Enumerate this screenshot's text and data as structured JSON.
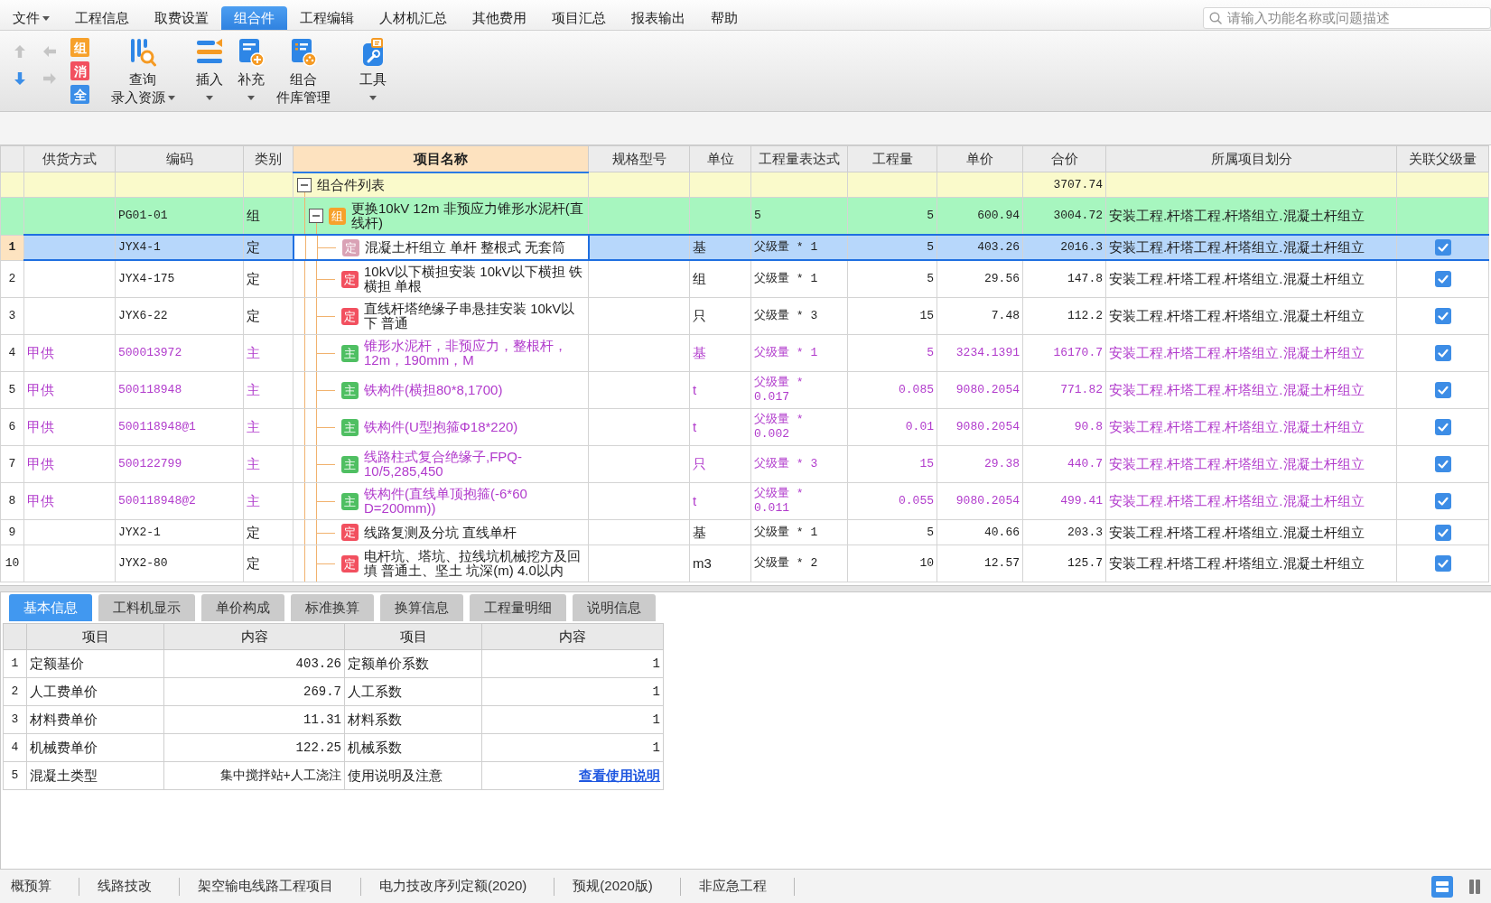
{
  "menu": {
    "items": [
      {
        "label": "文件",
        "dropdown": true,
        "selected": false
      },
      {
        "label": "工程信息",
        "dropdown": false,
        "selected": false
      },
      {
        "label": "取费设置",
        "dropdown": false,
        "selected": false
      },
      {
        "label": "组合件",
        "dropdown": false,
        "selected": true
      },
      {
        "label": "工程编辑",
        "dropdown": false,
        "selected": false
      },
      {
        "label": "人材机汇总",
        "dropdown": false,
        "selected": false
      },
      {
        "label": "其他费用",
        "dropdown": false,
        "selected": false
      },
      {
        "label": "项目汇总",
        "dropdown": false,
        "selected": false
      },
      {
        "label": "报表输出",
        "dropdown": false,
        "selected": false
      },
      {
        "label": "帮助",
        "dropdown": false,
        "selected": false
      }
    ]
  },
  "search": {
    "placeholder": "请输入功能名称或问题描述"
  },
  "toolbar": {
    "nav": [
      {
        "kind": "up",
        "disabled": true
      },
      {
        "kind": "back",
        "disabled": true
      },
      {
        "kind": "down",
        "disabled": false
      },
      {
        "kind": "forward",
        "disabled": true
      }
    ],
    "quick_buttons": [
      {
        "label": "组",
        "color": "#f7a12b"
      },
      {
        "label": "消",
        "color": "#f2505f"
      },
      {
        "label": "全",
        "color": "#3b8ee8"
      }
    ],
    "buttons": [
      {
        "kind": "query",
        "lines": [
          "查询",
          "录入资源"
        ],
        "dropdown": true
      },
      {
        "kind": "insert",
        "lines": [
          "插入"
        ],
        "dropdown": true
      },
      {
        "kind": "supplement",
        "lines": [
          "补充"
        ],
        "dropdown": true
      },
      {
        "kind": "library",
        "lines": [
          "组合",
          "件库管理"
        ],
        "dropdown": false
      },
      {
        "kind": "tools",
        "lines": [
          "工具"
        ],
        "dropdown": true
      }
    ]
  },
  "grid": {
    "columns": [
      {
        "label": "供货方式",
        "selected": false
      },
      {
        "label": "编码",
        "selected": false
      },
      {
        "label": "类别",
        "selected": false
      },
      {
        "label": "项目名称",
        "selected": true
      },
      {
        "label": "规格型号",
        "selected": false
      },
      {
        "label": "单位",
        "selected": false
      },
      {
        "label": "工程量表达式",
        "selected": false
      },
      {
        "label": "工程量",
        "selected": false
      },
      {
        "label": "单价",
        "selected": false
      },
      {
        "label": "合价",
        "selected": false
      },
      {
        "label": "所属项目划分",
        "selected": false
      },
      {
        "label": "关联父级量",
        "selected": false
      }
    ],
    "tree": [
      {
        "kind": "list",
        "name": "组合件列表",
        "total": "3707.74",
        "expanded": true,
        "selected": false,
        "children": [
          {
            "kind": "group",
            "code": "PG01-01",
            "type": "组",
            "badge": "组",
            "name": "更换10kV 12m 非预应力锥形水泥杆(直线杆)",
            "expression": "5",
            "quantity": "5",
            "unit_price": "600.94",
            "total": "3004.72",
            "division": "安装工程.杆塔工程.杆塔组立.混凝土杆组立",
            "expanded": true,
            "selected": false,
            "children": [
              {
                "kind": "quota",
                "no": "1",
                "code": "JYX4-1",
                "type": "定",
                "badge": "定",
                "name": "混凝土杆组立 单杆 整根式 无套筒",
                "unit": "基",
                "expression": "父级量 * 1",
                "quantity": "5",
                "unit_price": "403.26",
                "total": "2016.3",
                "division": "安装工程.杆塔工程.杆塔组立.混凝土杆组立",
                "linked": true,
                "selected": true
              },
              {
                "kind": "quota",
                "no": "2",
                "code": "JYX4-175",
                "type": "定",
                "badge": "定",
                "name": "10kV以下横担安装 10kV以下横担 铁横担 单根",
                "unit": "组",
                "expression": "父级量 * 1",
                "quantity": "5",
                "unit_price": "29.56",
                "total": "147.8",
                "division": "安装工程.杆塔工程.杆塔组立.混凝土杆组立",
                "linked": true,
                "selected": false
              },
              {
                "kind": "quota",
                "no": "3",
                "code": "JYX6-22",
                "type": "定",
                "badge": "定",
                "name": "直线杆塔绝缘子串悬挂安装 10kV以下 普通",
                "unit": "只",
                "expression": "父级量 * 3",
                "quantity": "15",
                "unit_price": "7.48",
                "total": "112.2",
                "division": "安装工程.杆塔工程.杆塔组立.混凝土杆组立",
                "linked": true,
                "selected": false
              },
              {
                "kind": "material",
                "no": "4",
                "supply": "甲供",
                "code": "500013972",
                "type": "主",
                "badge": "主",
                "name": "锥形水泥杆，非预应力，整根杆，12m，190mm，M",
                "unit": "基",
                "expression": "父级量 * 1",
                "quantity": "5",
                "unit_price": "3234.1391",
                "total": "16170.7",
                "division": "安装工程.杆塔工程.杆塔组立.混凝土杆组立",
                "linked": true,
                "selected": false
              },
              {
                "kind": "material",
                "no": "5",
                "supply": "甲供",
                "code": "500118948",
                "type": "主",
                "badge": "主",
                "name": "铁构件(横担80*8,1700)",
                "unit": "t",
                "expression": "父级量 * 0.017",
                "quantity": "0.085",
                "unit_price": "9080.2054",
                "total": "771.82",
                "division": "安装工程.杆塔工程.杆塔组立.混凝土杆组立",
                "linked": true,
                "selected": false
              },
              {
                "kind": "material",
                "no": "6",
                "supply": "甲供",
                "code": "500118948@1",
                "type": "主",
                "badge": "主",
                "name": "铁构件(U型抱箍Φ18*220)",
                "unit": "t",
                "expression": "父级量 * 0.002",
                "quantity": "0.01",
                "unit_price": "9080.2054",
                "total": "90.8",
                "division": "安装工程.杆塔工程.杆塔组立.混凝土杆组立",
                "linked": true,
                "selected": false
              },
              {
                "kind": "material",
                "no": "7",
                "supply": "甲供",
                "code": "500122799",
                "type": "主",
                "badge": "主",
                "name": "线路柱式复合绝缘子,FPQ-10/5,285,450",
                "unit": "只",
                "expression": "父级量 * 3",
                "quantity": "15",
                "unit_price": "29.38",
                "total": "440.7",
                "division": "安装工程.杆塔工程.杆塔组立.混凝土杆组立",
                "linked": true,
                "selected": false
              },
              {
                "kind": "material",
                "no": "8",
                "supply": "甲供",
                "code": "500118948@2",
                "type": "主",
                "badge": "主",
                "name": "铁构件(直线单顶抱箍(-6*60 D=200mm))",
                "unit": "t",
                "expression": "父级量 * 0.011",
                "quantity": "0.055",
                "unit_price": "9080.2054",
                "total": "499.41",
                "division": "安装工程.杆塔工程.杆塔组立.混凝土杆组立",
                "linked": true,
                "selected": false
              },
              {
                "kind": "quota",
                "no": "9",
                "code": "JYX2-1",
                "type": "定",
                "badge": "定",
                "name": "线路复测及分坑 直线单杆",
                "unit": "基",
                "expression": "父级量 * 1",
                "quantity": "5",
                "unit_price": "40.66",
                "total": "203.3",
                "division": "安装工程.杆塔工程.杆塔组立.混凝土杆组立",
                "linked": true,
                "selected": false
              },
              {
                "kind": "quota",
                "no": "10",
                "code": "JYX2-80",
                "type": "定",
                "badge": "定",
                "name": "电杆坑、塔坑、拉线坑机械挖方及回填 普通土、坚土 坑深(m) 4.0以内",
                "unit": "m3",
                "expression": "父级量 * 2",
                "quantity": "10",
                "unit_price": "12.57",
                "total": "125.7",
                "division": "安装工程.杆塔工程.杆塔组立.混凝土杆组立",
                "linked": true,
                "selected": false
              }
            ]
          }
        ]
      }
    ]
  },
  "detail_tabs": [
    {
      "label": "基本信息",
      "selected": true
    },
    {
      "label": "工料机显示",
      "selected": false
    },
    {
      "label": "单价构成",
      "selected": false
    },
    {
      "label": "标准换算",
      "selected": false
    },
    {
      "label": "换算信息",
      "selected": false
    },
    {
      "label": "工程量明细",
      "selected": false
    },
    {
      "label": "说明信息",
      "selected": false
    }
  ],
  "detail_table": {
    "columns": [
      "项目",
      "内容",
      "项目",
      "内容"
    ],
    "rows": [
      {
        "no": "1",
        "item_1": "定额基价",
        "content_1": "403.26",
        "item_2": "定额单价系数",
        "content_2": "1",
        "link": false
      },
      {
        "no": "2",
        "item_1": "人工费单价",
        "content_1": "269.7",
        "item_2": "人工系数",
        "content_2": "1",
        "link": false
      },
      {
        "no": "3",
        "item_1": "材料费单价",
        "content_1": "11.31",
        "item_2": "材料系数",
        "content_2": "1",
        "link": false
      },
      {
        "no": "4",
        "item_1": "机械费单价",
        "content_1": "122.25",
        "item_2": "机械系数",
        "content_2": "1",
        "link": false
      },
      {
        "no": "5",
        "item_1": "混凝土类型",
        "content_1": "集中搅拌站+人工浇注",
        "item_2": "使用说明及注意",
        "content_2": "查看使用说明",
        "link": true
      }
    ]
  },
  "status_bar": {
    "items": [
      "概预算",
      "线路技改",
      "架空输电线路工程项目",
      "电力技改序列定额(2020)",
      "预规(2020版)",
      "非应急工程"
    ],
    "view_buttons": [
      {
        "kind": "rows",
        "selected": true
      },
      {
        "kind": "columns",
        "selected": false
      }
    ]
  }
}
